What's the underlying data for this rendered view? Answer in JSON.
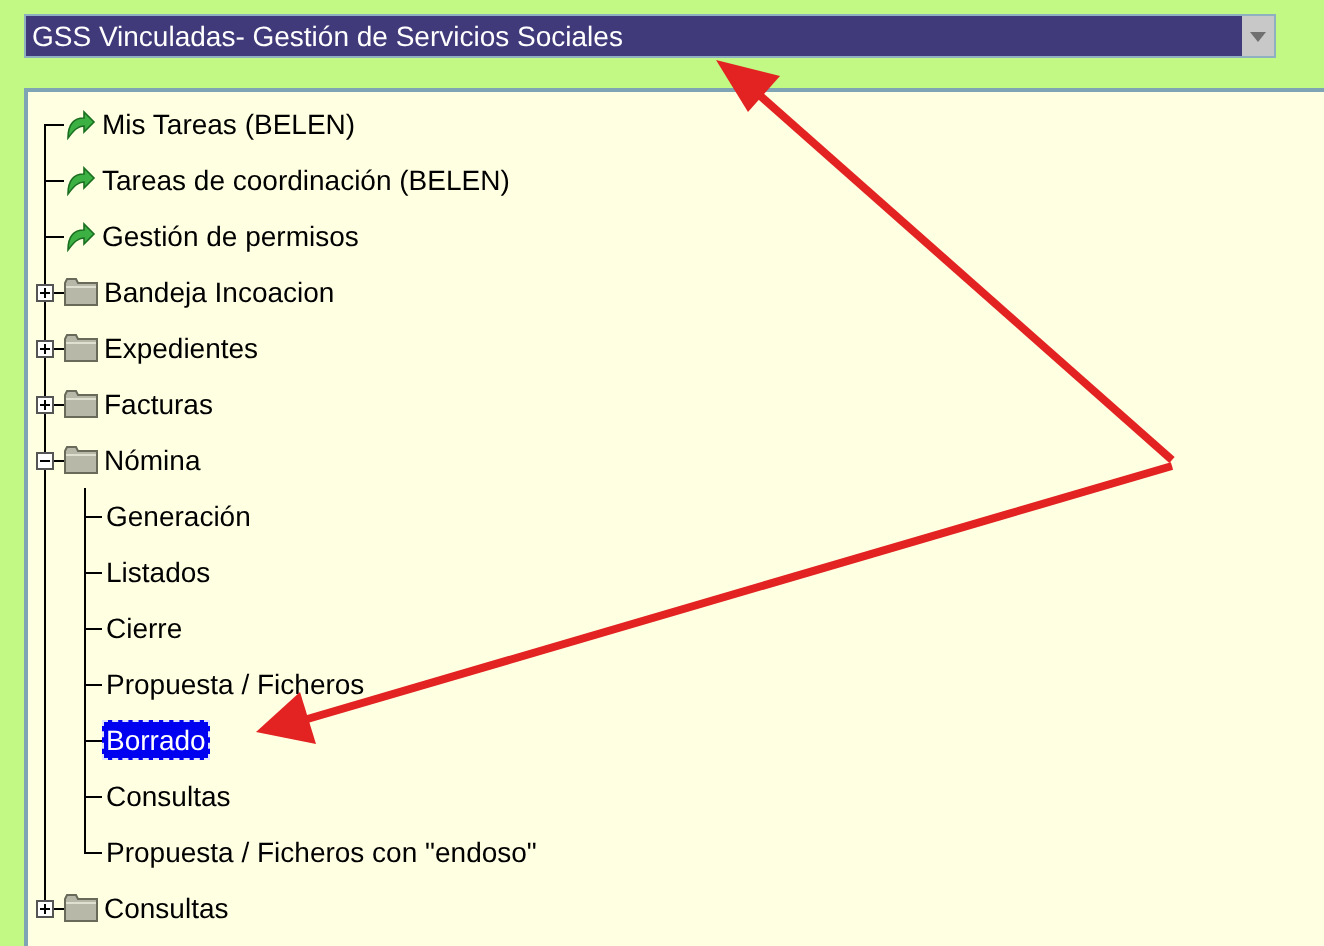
{
  "dropdown": {
    "value": "GSS Vinculadas- Gestión de Servicios Sociales"
  },
  "tree": [
    {
      "kind": "task",
      "label": "Mis Tareas (BELEN)",
      "selected": false
    },
    {
      "kind": "task",
      "label": "Tareas de coordinación (BELEN)",
      "selected": false
    },
    {
      "kind": "task",
      "label": "Gestión de permisos",
      "selected": false
    },
    {
      "kind": "folder",
      "label": "Bandeja Incoacion",
      "expanded": false,
      "selected": false
    },
    {
      "kind": "folder",
      "label": "Expedientes",
      "expanded": false,
      "selected": false
    },
    {
      "kind": "folder",
      "label": "Facturas",
      "expanded": false,
      "selected": false
    },
    {
      "kind": "folder",
      "label": "Nómina",
      "expanded": true,
      "selected": false,
      "children": [
        {
          "kind": "leaf",
          "label": "Generación",
          "selected": false
        },
        {
          "kind": "leaf",
          "label": "Listados",
          "selected": false
        },
        {
          "kind": "leaf",
          "label": "Cierre",
          "selected": false
        },
        {
          "kind": "leaf",
          "label": "Propuesta / Ficheros",
          "selected": false
        },
        {
          "kind": "leaf",
          "label": "Borrado",
          "selected": true
        },
        {
          "kind": "leaf",
          "label": "Consultas",
          "selected": false
        },
        {
          "kind": "leaf",
          "label": "Propuesta / Ficheros con \"endoso\"",
          "selected": false
        }
      ]
    },
    {
      "kind": "folder",
      "label": "Consultas",
      "expanded": false,
      "selected": false
    }
  ]
}
